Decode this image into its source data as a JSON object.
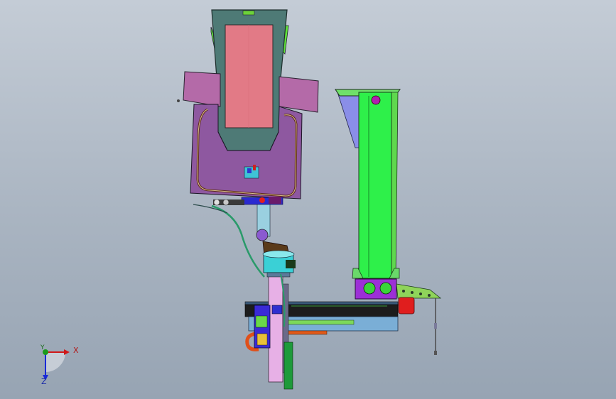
{
  "viewport": {
    "background_top": "#c4ccd6",
    "background_bottom": "#97a4b3"
  },
  "triad": {
    "x_label": "X",
    "y_label": "Y",
    "z_label": "Z",
    "x_color": "#d01818",
    "y_color": "#1a9a1a",
    "z_color": "#1a2ad8"
  },
  "model": {
    "hopper_color": "#4e7a76",
    "hopper_window_color": "#e27a86",
    "frame_plate_color": "#b46aa8",
    "column_color": "#2ef04a",
    "base_block_color": "#9c2fd6",
    "beam_color": "#1c1c1c",
    "slide_color": "#e7b0e6",
    "hose_color": "#2a9a6a"
  }
}
